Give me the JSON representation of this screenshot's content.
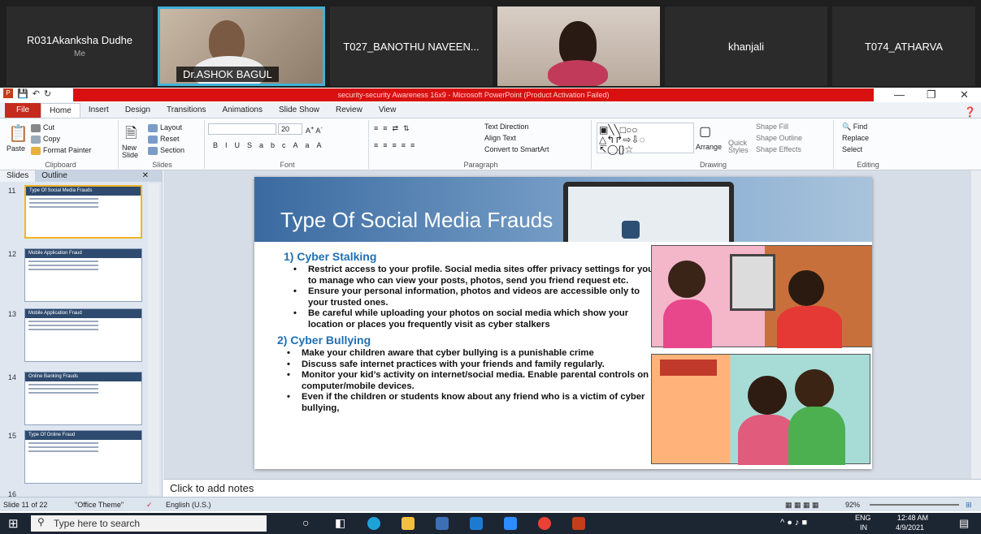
{
  "meeting": {
    "participants": [
      {
        "name": "R031Akanksha Dudhe",
        "sub": "Me"
      },
      {
        "name": "Dr.ASHOK BAGUL"
      },
      {
        "name": "T027_BANOTHU NAVEEN..."
      },
      {
        "name": "khanjali"
      },
      {
        "name": "T074_ATHARVA"
      }
    ]
  },
  "window": {
    "title": "security-security Awareness 16x9 - Microsoft PowerPoint (Product Activation Failed)"
  },
  "menu": {
    "file": "File",
    "tabs": [
      "Home",
      "Insert",
      "Design",
      "Transitions",
      "Animations",
      "Slide Show",
      "Review",
      "View"
    ]
  },
  "ribbon": {
    "clipboard": {
      "paste": "Paste",
      "cut": "Cut",
      "copy": "Copy",
      "format_painter": "Format Painter",
      "label": "Clipboard"
    },
    "slides": {
      "new_slide": "New Slide",
      "layout": "Layout",
      "reset": "Reset",
      "section": "Section",
      "label": "Slides"
    },
    "font": {
      "size": "20",
      "label": "Font"
    },
    "paragraph": {
      "text_direction": "Text Direction",
      "align_text": "Align Text",
      "convert_smartart": "Convert to SmartArt",
      "label": "Paragraph"
    },
    "drawing": {
      "arrange": "Arrange",
      "quick_styles": "Quick Styles",
      "shape_fill": "Shape Fill",
      "shape_outline": "Shape Outline",
      "shape_effects": "Shape Effects",
      "label": "Drawing"
    },
    "editing": {
      "find": "Find",
      "replace": "Replace",
      "select": "Select",
      "label": "Editing"
    }
  },
  "pane": {
    "tabs": [
      "Slides",
      "Outline"
    ],
    "thumbs": [
      {
        "num": "11",
        "title": "Type Of Social Media Frauds"
      },
      {
        "num": "12",
        "title": "Mobile Application Fraud"
      },
      {
        "num": "13",
        "title": "Mobile Application Fraud"
      },
      {
        "num": "14",
        "title": "Online Banking Frauds"
      },
      {
        "num": "15",
        "title": "Type Of Online Fraud"
      },
      {
        "num": "16",
        "title": ""
      }
    ]
  },
  "slide": {
    "title": "Type Of Social Media Frauds",
    "sections": [
      {
        "heading": "1) Cyber Stalking",
        "bullets": [
          "Restrict access to your profile. Social media sites offer privacy settings for you to manage who can view your posts, photos, send you friend request etc.",
          "Ensure your personal information, photos and videos are accessible only to your trusted ones.",
          "Be careful while uploading your photos on social media which show your location or places you frequently visit as cyber stalkers"
        ]
      },
      {
        "heading": "2) Cyber Bullying",
        "bullets": [
          "Make your children aware that cyber bullying is a punishable crime",
          "Discuss safe internet practices with your friends and family regularly.",
          "Monitor your kid’s activity on internet/social media. Enable parental controls on computer/mobile devices.",
          "Even if the children or students know about any friend who is a victim of cyber bullying,"
        ]
      }
    ]
  },
  "notes": {
    "placeholder": "Click to add notes"
  },
  "status": {
    "slide": "Slide 11 of 22",
    "theme": "\"Office Theme\"",
    "language": "English (U.S.)",
    "zoom": "92%"
  },
  "taskbar": {
    "search": "Type here to search",
    "lang": "ENG",
    "region": "IN",
    "time": "12:48 AM",
    "date": "4/9/2021"
  }
}
